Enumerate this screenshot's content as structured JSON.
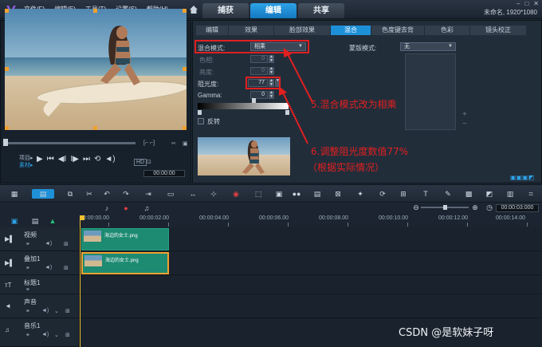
{
  "menu": [
    "文件(F)",
    "编辑(E)",
    "工具(T)",
    "设置(S)",
    "帮助(H)"
  ],
  "main_tabs": [
    "捕获",
    "编辑",
    "共享"
  ],
  "project_info": "未命名, 1920*1080",
  "preview": {
    "labels": {
      "project": "项目▸",
      "clip": "素材▸"
    },
    "timecode": "00:00:00",
    "transport_icons": [
      "play-icon",
      "start-icon",
      "prev-frame-icon",
      "next-frame-icon",
      "end-icon",
      "repeat-icon",
      "volume-icon"
    ],
    "hd_label": "HD"
  },
  "attr": {
    "subtabs": [
      "编辑",
      "效果",
      "脸部效果",
      "混合",
      "色度键去背",
      "色彩",
      "镜头校正"
    ],
    "active_subtab": 3,
    "blend_mode_label": "混合模式:",
    "blend_mode_value": "相乘",
    "hue_label": "色相:",
    "hue_value": "0",
    "brightness_label": "亮度:",
    "brightness_value": "0",
    "opacity_label": "阻光度:",
    "opacity_value": "77",
    "gamma_label": "Gamma:",
    "gamma_value": "0",
    "invert_label": "反转",
    "mask_mode_label": "蒙版模式:",
    "mask_mode_value": "无"
  },
  "annotations": {
    "step5": "5.混合模式改为相乘",
    "step6_line1": "6.调整阻光度数值77%",
    "step6_line2": "（根据实际情况）"
  },
  "timeline": {
    "timecode": "00:00:03:000",
    "ruler": [
      "00:00:00.00",
      "00:00:02.00",
      "00:00:04.00",
      "00:00:06.00",
      "00:00:08.00",
      "00:00:10.00",
      "00:00:12.00",
      "00:00:14.00"
    ],
    "tracks": [
      "视频",
      "叠加1",
      "标题1",
      "声音",
      "音乐1"
    ],
    "clip_name": "海边的女士.png"
  },
  "watermark": "CSDN @是软妹子呀",
  "colors": {
    "accent": "#1e90d8",
    "annotation": "#e02020",
    "clip": "#1d8a72",
    "selection": "#f0a030"
  }
}
